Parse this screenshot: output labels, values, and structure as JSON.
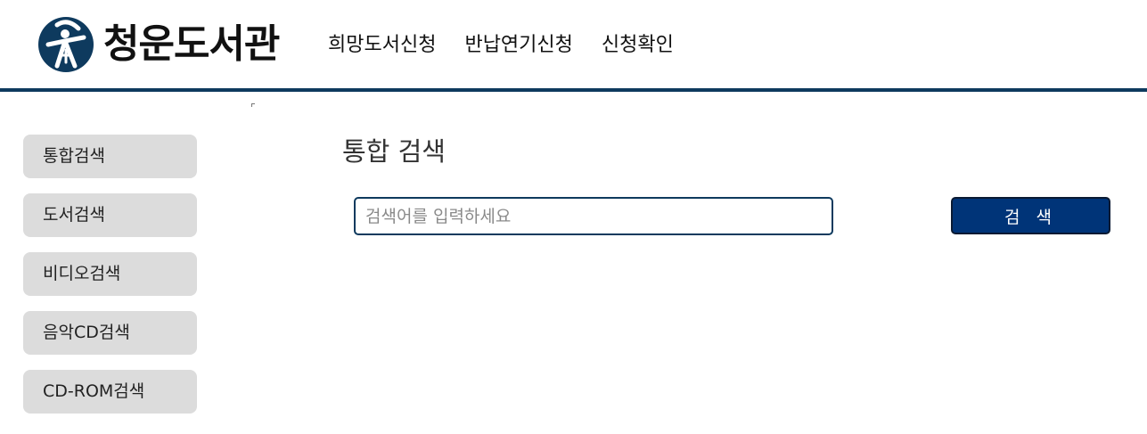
{
  "header": {
    "logo_text": "청운도서관",
    "logo_icon": "library-emblem-icon",
    "nav": [
      {
        "label": "희망도서신청"
      },
      {
        "label": "반납연기신청"
      },
      {
        "label": "신청확인"
      }
    ]
  },
  "sidebar": {
    "items": [
      {
        "label": "통합검색"
      },
      {
        "label": "도서검색"
      },
      {
        "label": "비디오검색"
      },
      {
        "label": "음악CD검색"
      },
      {
        "label": "CD-ROM검색"
      }
    ]
  },
  "main": {
    "title": "통합 검색",
    "search": {
      "placeholder": "검색어를 입력하세요",
      "value": "",
      "button_label": "검 색"
    }
  },
  "colors": {
    "brand_navy": "#0e3a5e",
    "button_blue": "#003478",
    "sidebar_gray": "#dcdcdc"
  }
}
